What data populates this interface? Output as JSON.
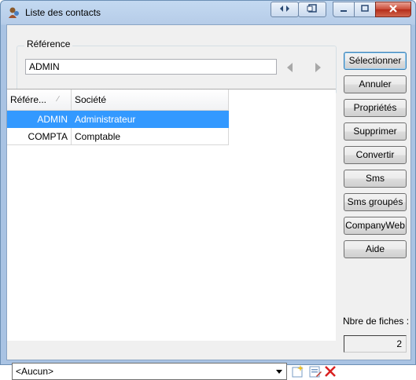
{
  "window": {
    "title": "Liste des contacts"
  },
  "reference": {
    "label": "Référence",
    "value": "ADMIN"
  },
  "grid": {
    "columns": [
      "Référe...",
      "Société"
    ],
    "rows": [
      {
        "reference": "ADMIN",
        "societe": "Administrateur",
        "selected": true
      },
      {
        "reference": "COMPTA",
        "societe": "Comptable",
        "selected": false
      }
    ]
  },
  "buttons": {
    "select": "Sélectionner",
    "cancel": "Annuler",
    "properties": "Propriétés",
    "delete": "Supprimer",
    "convert": "Convertir",
    "sms": "Sms",
    "sms_group": "Sms groupés",
    "companyweb": "CompanyWeb",
    "help": "Aide"
  },
  "count": {
    "label": "Nbre de fiches :",
    "value": "2"
  },
  "filter": {
    "selected": "<Aucun>"
  },
  "icons": {
    "app": "contacts-icon",
    "new": "new-item-icon",
    "edit": "edit-icon",
    "delete": "delete-icon"
  },
  "colors": {
    "selection": "#3399ff",
    "delete": "#d92020"
  }
}
